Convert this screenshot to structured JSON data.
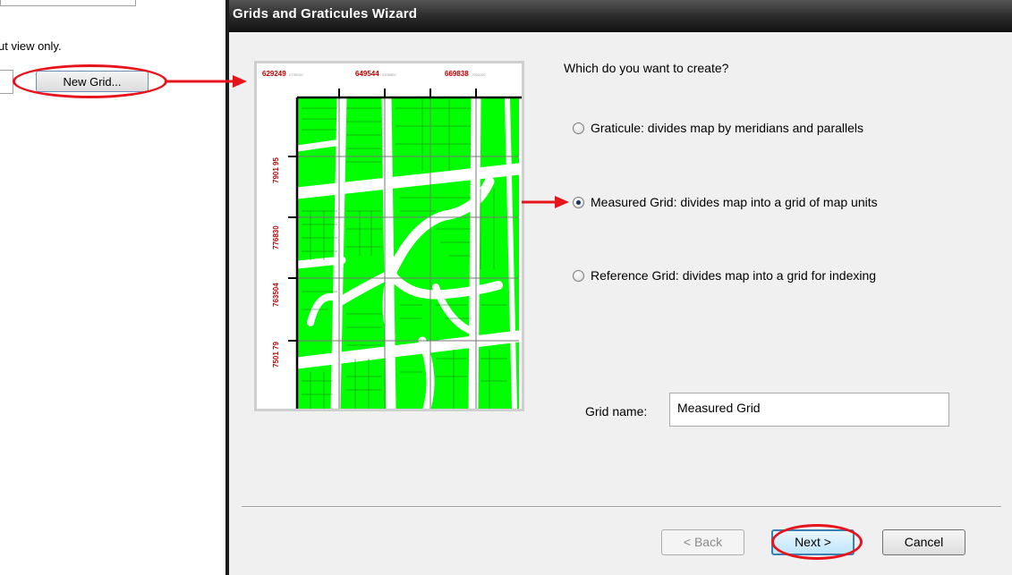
{
  "prev_dialog": {
    "hint_text": "ut view only.",
    "new_grid_button": "New Grid..."
  },
  "wizard": {
    "title": "Grids and Graticules Wizard",
    "question": "Which do you want to create?",
    "options": [
      {
        "label": "Graticule: divides map by meridians and parallels",
        "checked": false
      },
      {
        "label": "Measured Grid: divides map into a grid of map units",
        "checked": true
      },
      {
        "label": "Reference Grid: divides map into a grid for indexing",
        "checked": false
      }
    ],
    "grid_name": {
      "label": "Grid name:",
      "value": "Measured Grid"
    },
    "buttons": {
      "back": "< Back",
      "next": "Next >",
      "cancel": "Cancel"
    }
  },
  "preview": {
    "top_labels": [
      "629249",
      "649544",
      "669838"
    ],
    "side_labels": [
      "7901 95",
      "776830",
      "763504",
      "7501 79"
    ],
    "map_color": "#00ff00",
    "label_color": "#c00000"
  },
  "annotations": {
    "highlight_color": "#e8141c"
  }
}
